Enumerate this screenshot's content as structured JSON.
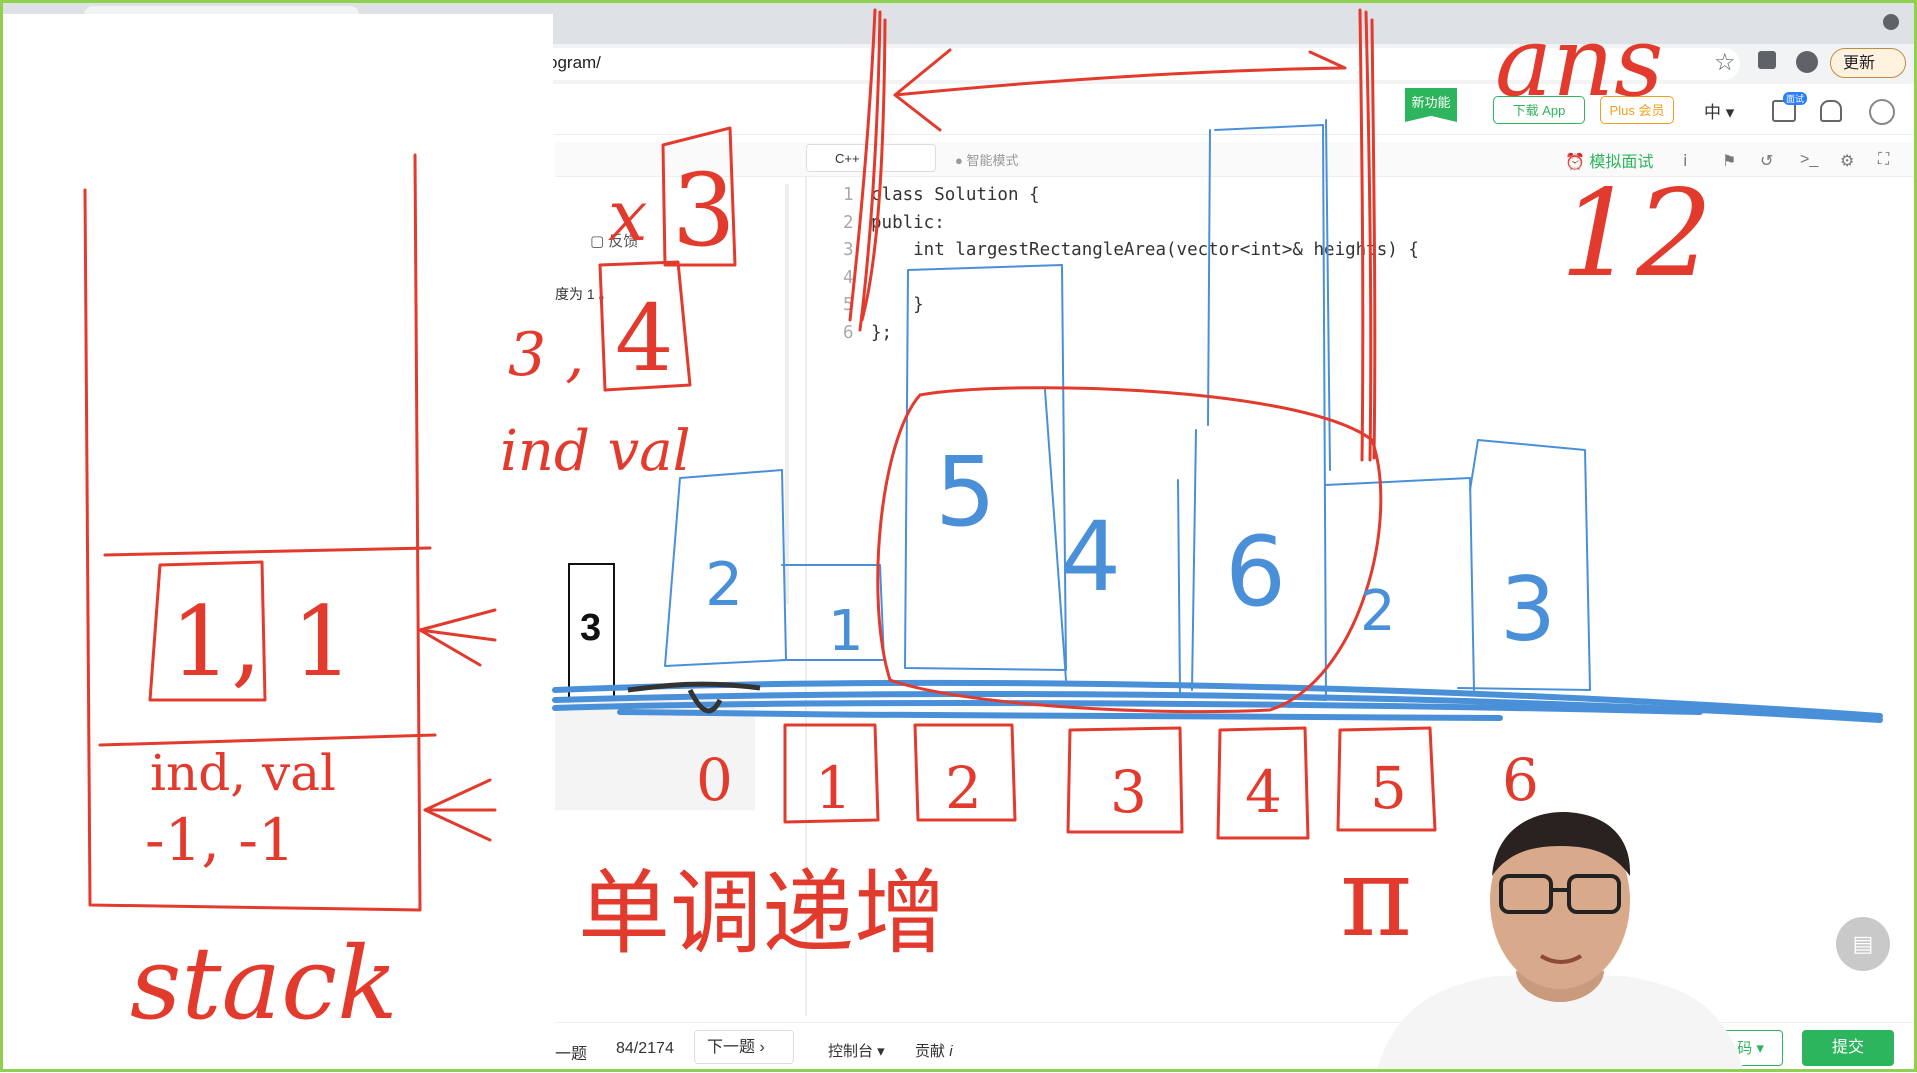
{
  "browser": {
    "url_fragment": "ogram/",
    "update_label": "更新"
  },
  "header": {
    "new_feature": "新功能",
    "download_app": "下载 App",
    "plus_member": "Plus 会员",
    "language": "中",
    "interview_badge": "面试"
  },
  "editor": {
    "language": "C++",
    "smart_mode": "智能模式",
    "mock_interview": "模拟面试",
    "code_lines": [
      {
        "num": "1",
        "text": "class Solution {"
      },
      {
        "num": "2",
        "text": "public:"
      },
      {
        "num": "3",
        "text": "    int largestRectangleArea(vector<int>& heights) {"
      },
      {
        "num": "4",
        "text": ""
      },
      {
        "num": "5",
        "text": "    }"
      },
      {
        "num": "6",
        "text": "};"
      }
    ]
  },
  "problem_panel": {
    "feedback": "反馈",
    "desc_fragment": "度为 1 。",
    "bar_value": "3"
  },
  "bottom": {
    "prev": "一题",
    "page_count": "84/2174",
    "next": "下一题",
    "console": "控制台",
    "contribute": "贡献",
    "run": "码",
    "submit": "提交"
  },
  "annotations": {
    "ans_label": "ans",
    "ans_value": "12",
    "x_label": "x",
    "x_value": "3",
    "pair_label": "3 ,",
    "pair_value": "4",
    "ind_val_label": "ind val",
    "bar_heights": [
      "2",
      "1",
      "5",
      "4",
      "6",
      "2",
      "3"
    ],
    "indices": [
      "0",
      "1",
      "2",
      "3",
      "4",
      "5",
      "6"
    ],
    "monotonic_label": "单调递增",
    "pointer_label": "π",
    "stack_top_entry": "1, 1",
    "stack_bottom_header": "ind, val",
    "stack_bottom_entry": "-1, -1",
    "stack_label": "stack"
  }
}
